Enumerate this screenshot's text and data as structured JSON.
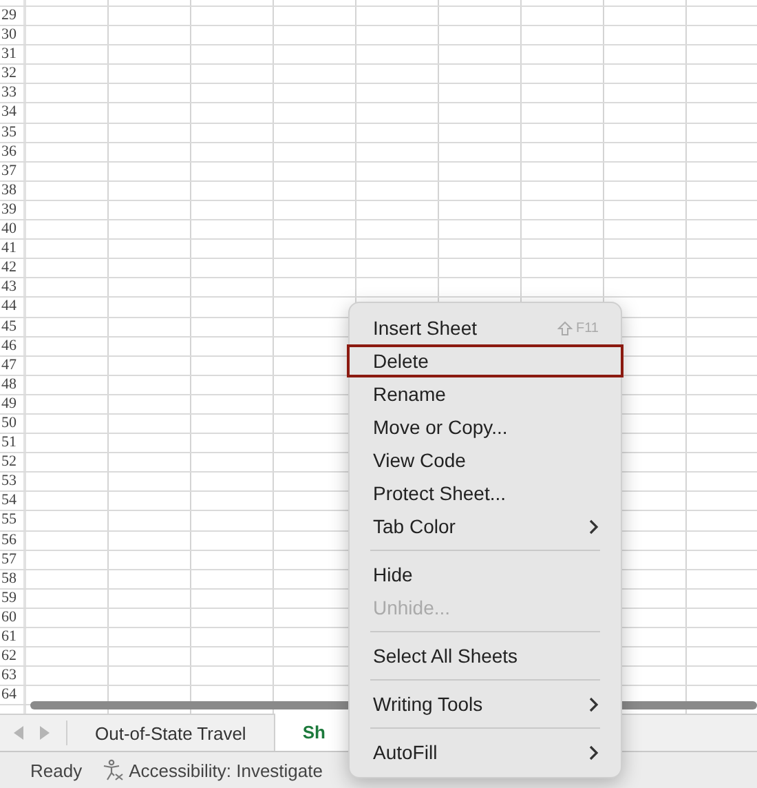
{
  "sheet": {
    "row_numbers": [
      "29",
      "30",
      "31",
      "32",
      "33",
      "34",
      "35",
      "36",
      "37",
      "38",
      "39",
      "40",
      "41",
      "42",
      "43",
      "44",
      "45",
      "46",
      "47",
      "48",
      "49",
      "50",
      "51",
      "52",
      "53",
      "54",
      "55",
      "56",
      "57",
      "58",
      "59",
      "60",
      "61",
      "62",
      "63",
      "64"
    ]
  },
  "sheet_tabs": [
    {
      "label": "Out-of-State Travel",
      "selected": false
    },
    {
      "label": "Sh",
      "selected": true
    }
  ],
  "status_bar": {
    "status": "Ready",
    "accessibility": "Accessibility: Investigate"
  },
  "context_menu": [
    {
      "kind": "item",
      "label": "Insert Sheet",
      "shortcut": "F11",
      "selected": false,
      "disabled": false,
      "submenu": false
    },
    {
      "kind": "item",
      "label": "Delete",
      "selected": true,
      "disabled": false,
      "submenu": false
    },
    {
      "kind": "item",
      "label": "Rename",
      "selected": false,
      "disabled": false,
      "submenu": false
    },
    {
      "kind": "item",
      "label": "Move or Copy...",
      "selected": false,
      "disabled": false,
      "submenu": false
    },
    {
      "kind": "item",
      "label": "View Code",
      "selected": false,
      "disabled": false,
      "submenu": false
    },
    {
      "kind": "item",
      "label": "Protect Sheet...",
      "selected": false,
      "disabled": false,
      "submenu": false
    },
    {
      "kind": "item",
      "label": "Tab Color",
      "selected": false,
      "disabled": false,
      "submenu": true
    },
    {
      "kind": "separator"
    },
    {
      "kind": "item",
      "label": "Hide",
      "selected": false,
      "disabled": false,
      "submenu": false
    },
    {
      "kind": "item",
      "label": "Unhide...",
      "selected": false,
      "disabled": true,
      "submenu": false
    },
    {
      "kind": "separator"
    },
    {
      "kind": "item",
      "label": "Select All Sheets",
      "selected": false,
      "disabled": false,
      "submenu": false
    },
    {
      "kind": "separator"
    },
    {
      "kind": "item",
      "label": "Writing Tools",
      "selected": false,
      "disabled": false,
      "submenu": true
    },
    {
      "kind": "separator"
    },
    {
      "kind": "item",
      "label": "AutoFill",
      "selected": false,
      "disabled": false,
      "submenu": true
    }
  ]
}
